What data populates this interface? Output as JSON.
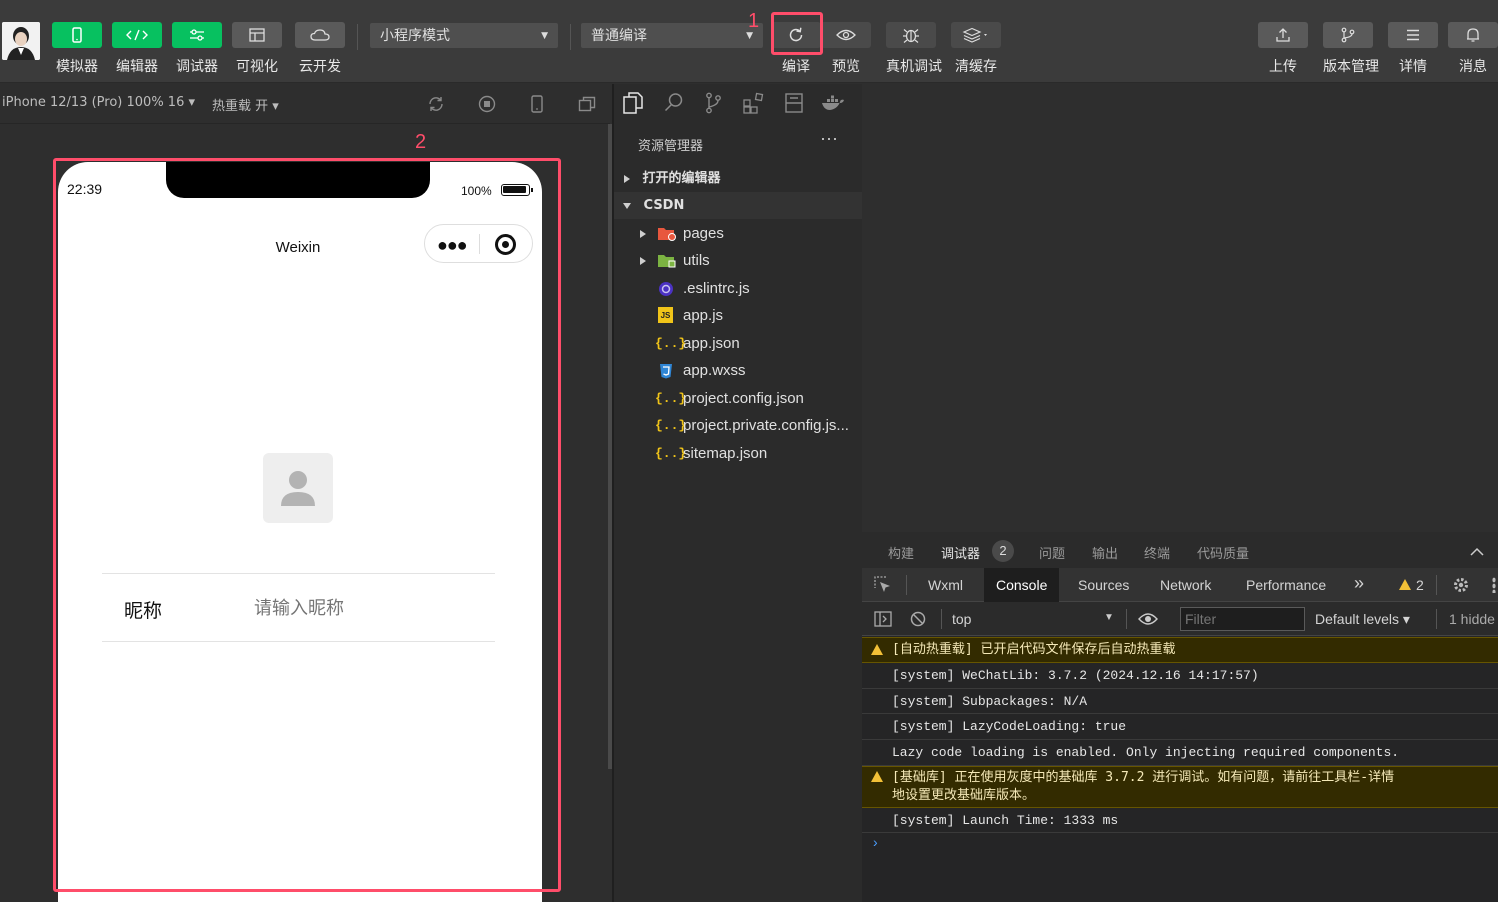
{
  "toolbar": {
    "left_buttons": [
      {
        "label": "模拟器",
        "icon": "phone-icon"
      },
      {
        "label": "编辑器",
        "icon": "code-icon"
      },
      {
        "label": "调试器",
        "icon": "debug-sliders-icon"
      },
      {
        "label": "可视化",
        "icon": "layout-icon"
      },
      {
        "label": "云开发",
        "icon": "cloud-icon"
      }
    ],
    "mode_select": "小程序模式",
    "compile_select": "普通编译",
    "mid_buttons": [
      {
        "label": "编译",
        "icon": "refresh-icon"
      },
      {
        "label": "预览",
        "icon": "eye-icon"
      },
      {
        "label": "真机调试",
        "icon": "bug-icon"
      },
      {
        "label": "清缓存",
        "icon": "layers-icon"
      }
    ],
    "right_buttons": [
      {
        "label": "上传",
        "icon": "upload-icon"
      },
      {
        "label": "版本管理",
        "icon": "branch-icon"
      },
      {
        "label": "详情",
        "icon": "menu-icon"
      },
      {
        "label": "消息",
        "icon": "bell-icon"
      }
    ]
  },
  "annotations": {
    "one": "1",
    "two": "2"
  },
  "simulator": {
    "device": "iPhone 12/13 (Pro) 100% 16 ▾",
    "hot_reload": "热重载 开 ▾",
    "phone": {
      "time": "22:39",
      "battery": "100%",
      "nav_title": "Weixin",
      "nickname_label": "昵称",
      "nickname_placeholder": "请输入昵称"
    }
  },
  "explorer": {
    "title": "资源管理器",
    "more": "···",
    "open_editors": "打开的编辑器",
    "project": "CSDN",
    "items": [
      {
        "name": "pages",
        "type": "folder"
      },
      {
        "name": "utils",
        "type": "folder"
      },
      {
        "name": ".eslintrc.js",
        "type": "eslint"
      },
      {
        "name": "app.js",
        "type": "js"
      },
      {
        "name": "app.json",
        "type": "json"
      },
      {
        "name": "app.wxss",
        "type": "css"
      },
      {
        "name": "project.config.json",
        "type": "json"
      },
      {
        "name": "project.private.config.js...",
        "type": "json"
      },
      {
        "name": "sitemap.json",
        "type": "json"
      }
    ]
  },
  "debug": {
    "tabs": [
      "构建",
      "调试器",
      "问题",
      "输出",
      "终端",
      "代码质量"
    ],
    "debugger_badge": "2",
    "console_tabs": [
      "Wxml",
      "Console",
      "Sources",
      "Network",
      "Performance"
    ],
    "more_tabs": "»",
    "warning_count": "2",
    "context": "top",
    "filter_placeholder": "Filter",
    "levels": "Default levels ▾",
    "hidden": "1 hidde",
    "logs": [
      {
        "level": "warn",
        "text": "[自动热重载] 已开启代码文件保存后自动热重载"
      },
      {
        "level": "info",
        "text": "[system] WeChatLib: 3.7.2 (2024.12.16 14:17:57)"
      },
      {
        "level": "info",
        "text": "[system] Subpackages: N/A"
      },
      {
        "level": "info",
        "text": "[system] LazyCodeLoading: true"
      },
      {
        "level": "info",
        "text": "Lazy code loading is enabled. Only injecting required components."
      },
      {
        "level": "warn",
        "text": "[基础库] 正在使用灰度中的基础库 3.7.2 进行调试。如有问题，请前往工具栏-详情-本地设置更改基础库版本。",
        "line1": "[基础库] 正在使用灰度中的基础库 3.7.2 进行调试。如有问题，请前往工具栏-详情",
        "line2": "地设置更改基础库版本。"
      },
      {
        "level": "info",
        "text": "[system] Launch Time: 1333 ms"
      }
    ],
    "prompt": "›"
  },
  "colors": {
    "accent_green": "#07c160",
    "annotation_red": "#ff4d6a",
    "warning_yellow": "#f2c037"
  }
}
